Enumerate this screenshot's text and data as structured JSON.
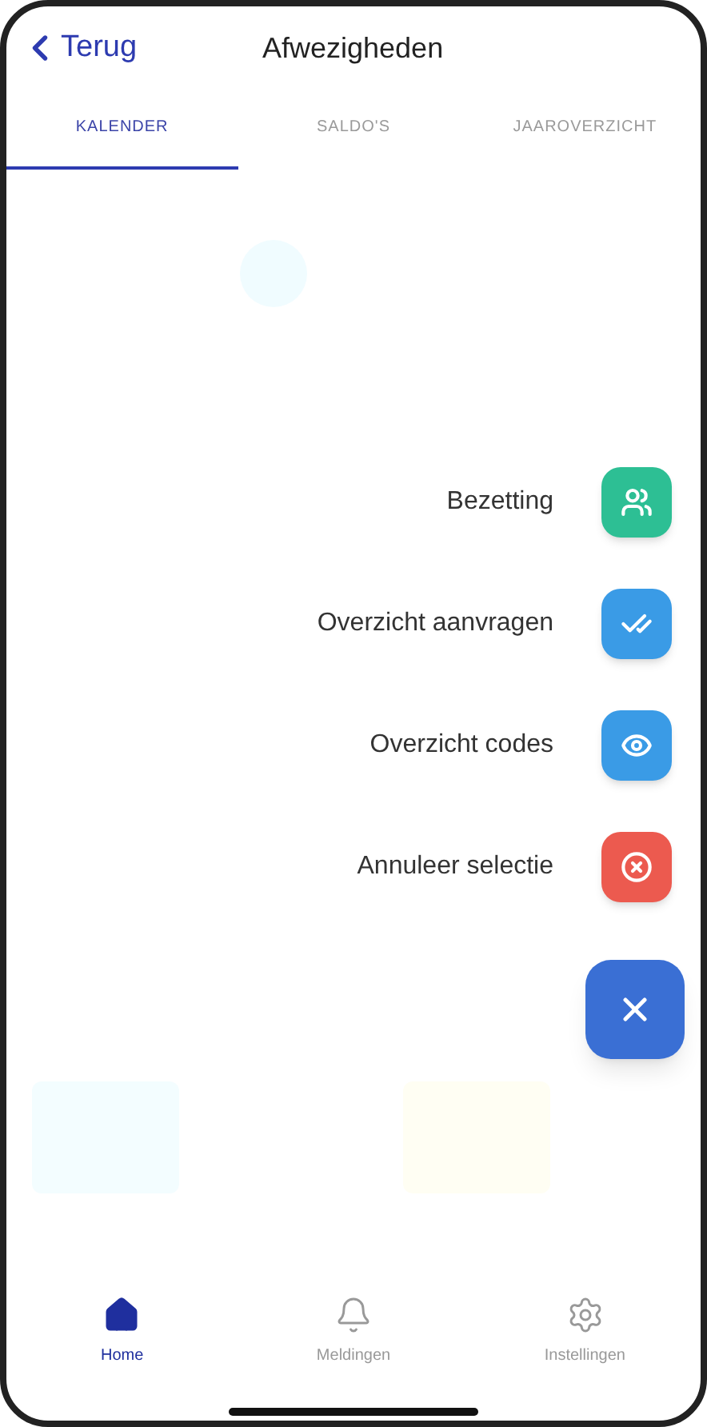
{
  "header": {
    "back": "Terug",
    "title": "Afwezigheden"
  },
  "tabs": [
    {
      "label": "KALENDER",
      "selected": true
    },
    {
      "label": "SALDO'S",
      "selected": false
    },
    {
      "label": "JAAROVERZICHT",
      "selected": false
    }
  ],
  "actions": [
    {
      "label": "Bezetting",
      "kind": "people",
      "color": "#2dbf94"
    },
    {
      "label": "Overzicht aanvragen",
      "kind": "double-check",
      "color": "#3a9be6"
    },
    {
      "label": "Overzicht codes",
      "kind": "eye",
      "color": "#3a9be6"
    },
    {
      "label": "Annuleer selectie",
      "kind": "cancel",
      "color": "#ec5a4f"
    }
  ],
  "bottom_nav": [
    {
      "label": "Home",
      "kind": "home",
      "selected": true
    },
    {
      "label": "Meldingen",
      "kind": "bell",
      "selected": false
    },
    {
      "label": "Instellingen",
      "kind": "settings",
      "selected": false
    }
  ]
}
